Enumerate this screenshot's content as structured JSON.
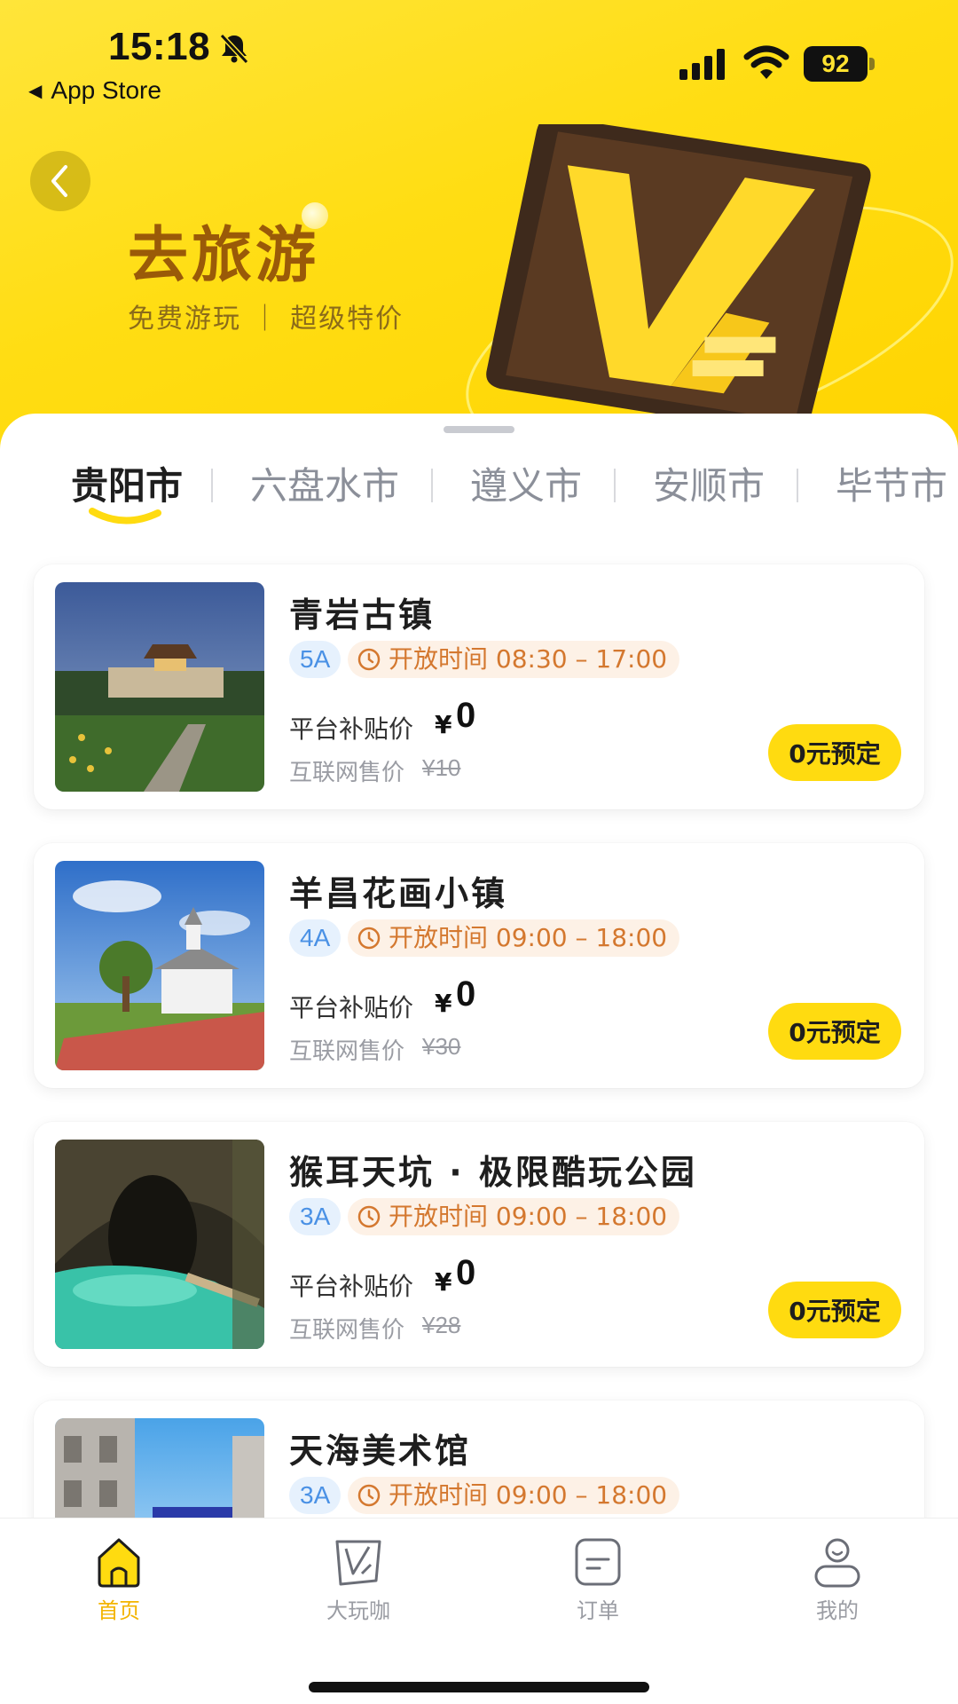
{
  "status_bar": {
    "time": "15:18",
    "back_app": "App Store",
    "battery": "92"
  },
  "hero": {
    "title": "去旅游",
    "subtitle": "免费游玩 ｜ 超级特价"
  },
  "tabs": [
    {
      "label": "贵阳市"
    },
    {
      "label": "六盘水市"
    },
    {
      "label": "遵义市"
    },
    {
      "label": "安顺市"
    },
    {
      "label": "毕节市"
    }
  ],
  "cards": [
    {
      "name": "青岩古镇",
      "grade": "5A",
      "hours": "开放时间 08:30 – 17:00",
      "price_label": "平台补贴价",
      "currency": "¥",
      "price": "0",
      "market_label": "互联网售价",
      "market_price": "¥10",
      "button": "0元预定"
    },
    {
      "name": "羊昌花画小镇",
      "grade": "4A",
      "hours": "开放时间 09:00 – 18:00",
      "price_label": "平台补贴价",
      "currency": "¥",
      "price": "0",
      "market_label": "互联网售价",
      "market_price": "¥30",
      "button": "0元预定"
    },
    {
      "name": "猴耳天坑 · 极限酷玩公园",
      "grade": "3A",
      "hours": "开放时间 09:00 – 18:00",
      "price_label": "平台补贴价",
      "currency": "¥",
      "price": "0",
      "market_label": "互联网售价",
      "market_price": "¥28",
      "button": "0元预定"
    },
    {
      "name": "天海美术馆",
      "grade": "3A",
      "hours": "开放时间 09:00 – 18:00"
    }
  ],
  "bottom_nav": [
    {
      "label": "首页",
      "icon": "home-icon",
      "active": true
    },
    {
      "label": "大玩咖",
      "icon": "v-card-icon",
      "active": false
    },
    {
      "label": "订单",
      "icon": "order-icon",
      "active": false
    },
    {
      "label": "我的",
      "icon": "profile-icon",
      "active": false
    }
  ],
  "colors": {
    "accent": "#ffdb10",
    "title_brown": "#9a5a08",
    "grade_blue": "#4a91e5",
    "hours_orange": "#d4782f",
    "nav_active": "#f3b400"
  }
}
